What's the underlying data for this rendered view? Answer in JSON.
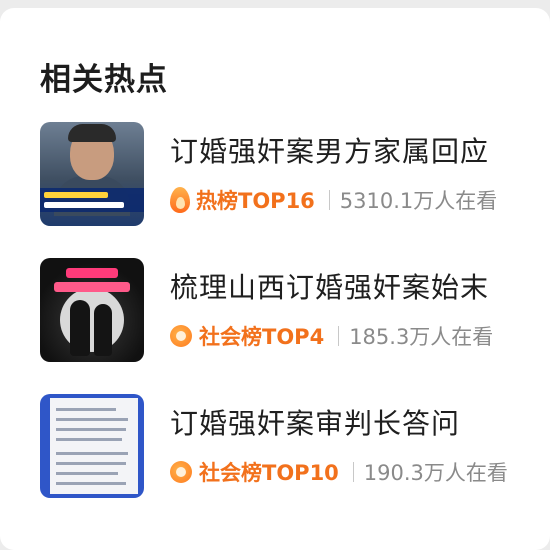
{
  "section": {
    "title": "相关热点"
  },
  "items": [
    {
      "title": "订婚强奸案男方家属回应",
      "rank": "热榜TOP16",
      "views": "5310.1万人在看",
      "icon": "fire-icon"
    },
    {
      "title": "梳理山西订婚强奸案始末",
      "rank": "社会榜TOP4",
      "views": "185.3万人在看",
      "icon": "orange-circle-icon"
    },
    {
      "title": "订婚强奸案审判长答问",
      "rank": "社会榜TOP10",
      "views": "190.3万人在看",
      "icon": "orange-circle-icon"
    }
  ],
  "colors": {
    "rank": "#f2711c",
    "views": "#8a8a8a",
    "title": "#1f1f1f"
  }
}
